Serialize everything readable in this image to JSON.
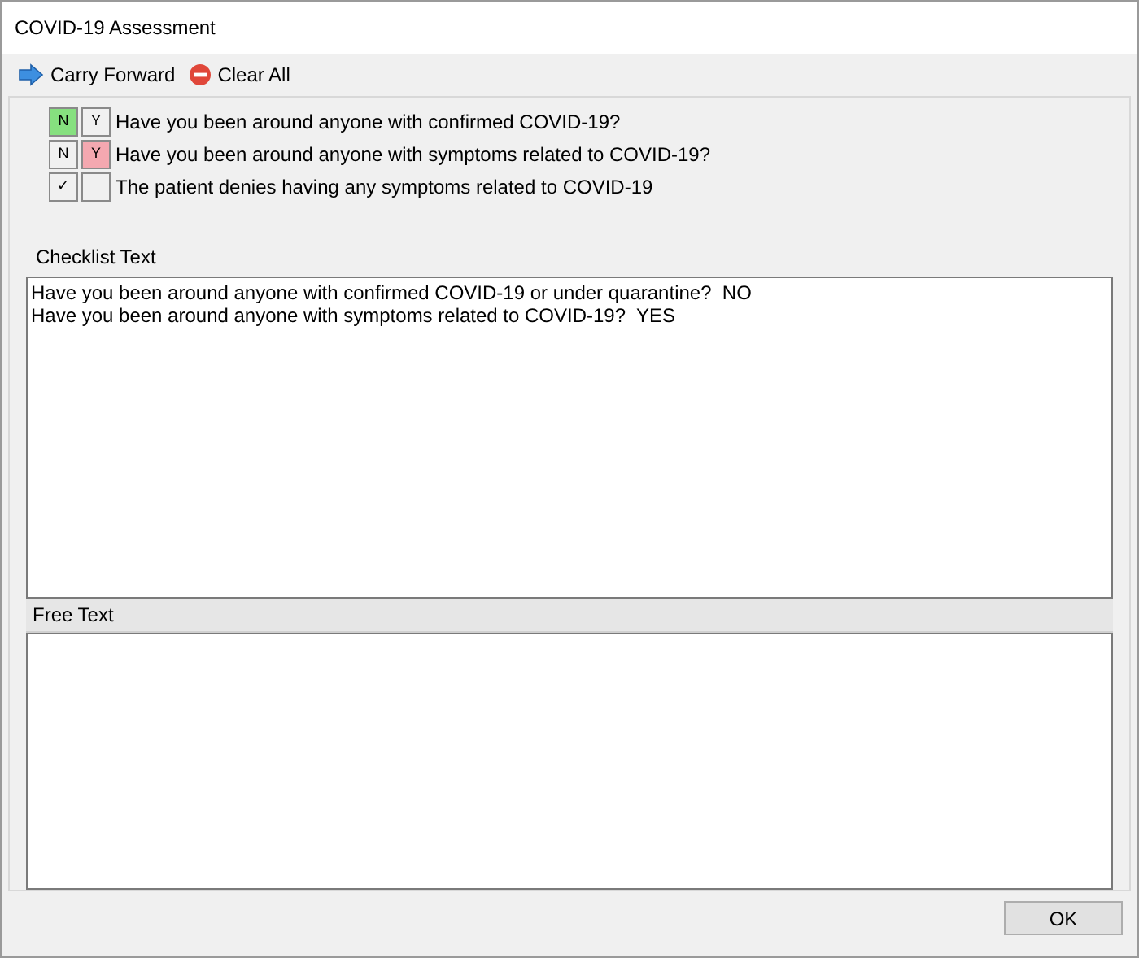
{
  "window": {
    "title": "COVID-19 Assessment"
  },
  "toolbar": [
    {
      "kind": "carry",
      "label": "Carry Forward"
    },
    {
      "kind": "clear",
      "label": "Clear All"
    }
  ],
  "questions": [
    {
      "kind": "answer",
      "options": [
        {
          "label": "N",
          "selected": true
        },
        {
          "label": "Y",
          "selected": false
        }
      ],
      "text": "Have you been around anyone with confirmed COVID-19?"
    },
    {
      "kind": "answer",
      "options": [
        {
          "label": "N",
          "selected": false
        },
        {
          "label": "Y",
          "selected": true
        }
      ],
      "text": "Have you been around anyone with symptoms related to COVID-19?"
    },
    {
      "kind": "check",
      "checked": true,
      "tick": "✓",
      "text": "The patient denies having any symptoms related to COVID-19"
    }
  ],
  "checklist": {
    "label": "Checklist Text",
    "lines": [
      "Have you been around anyone with confirmed COVID-19 or under quarantine?  NO",
      "Have you been around anyone with symptoms related to COVID-19?  YES"
    ]
  },
  "free_text": {
    "label": "Free Text"
  },
  "buttons": [
    "OK"
  ]
}
